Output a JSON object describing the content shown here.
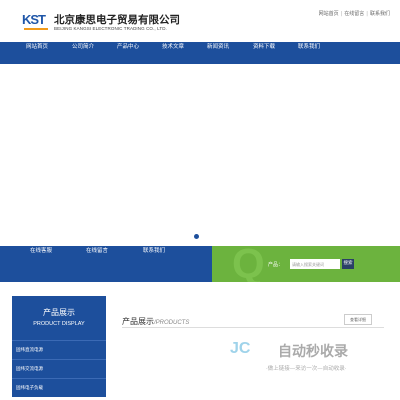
{
  "brand": {
    "logo_text": "KST",
    "name_cn": "北京康思电子贸易有限公司",
    "name_en": "BEIJING KANGSI ELECTRONIC TRADING CO., LTD."
  },
  "toplinks": [
    "网站首页",
    "在线留言",
    "联系我们"
  ],
  "nav": [
    "网站首页",
    "公司简介",
    "产品中心",
    "技术文章",
    "新闻资讯",
    "资料下载",
    "联系我们"
  ],
  "strip": {
    "links": [
      "在线客服",
      "在线留言",
      "联系我们"
    ],
    "search_label": "产品：",
    "search_placeholder": "请输入搜索关键词",
    "search_button": "搜索"
  },
  "sidebar": {
    "title_cn": "产品展示",
    "title_en": "PRODUCT DISPLAY",
    "items": [
      "固纬直流电源",
      "固纬交流电源",
      "固纬电子负载",
      "固纬示波器"
    ]
  },
  "main": {
    "title_cn": "产品展示",
    "title_en": "/PRODUCTS",
    "more_label": "查看详细"
  },
  "watermark": {
    "logo": "JC",
    "text": "自动秒收录",
    "sub": "·做上链接—来访一次—自动收录·"
  },
  "colors": {
    "primary": "#1d4f9c",
    "green": "#6cb33e",
    "accent": "#f29b1a"
  }
}
